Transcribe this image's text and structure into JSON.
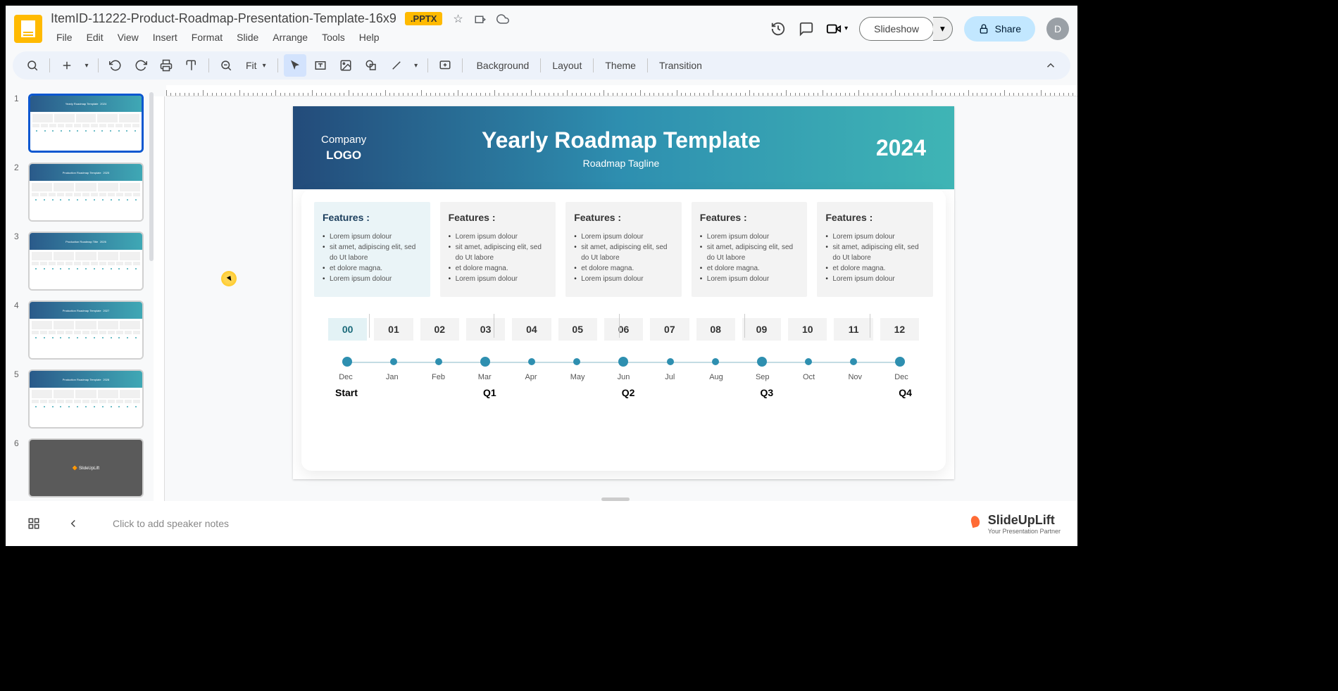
{
  "doc": {
    "name": "ItemID-11222-Product-Roadmap-Presentation-Template-16x9",
    "badge": ".PPTX"
  },
  "menus": [
    "File",
    "Edit",
    "View",
    "Insert",
    "Format",
    "Slide",
    "Arrange",
    "Tools",
    "Help"
  ],
  "header_actions": {
    "slideshow": "Slideshow",
    "share": "Share",
    "avatar": "D"
  },
  "toolbar": {
    "zoom": "Fit",
    "text_tools": [
      "Background",
      "Layout",
      "Theme",
      "Transition"
    ]
  },
  "thumbnails": [
    {
      "num": "1",
      "title": "Yearly Roadmap Template",
      "year": "2024",
      "active": true
    },
    {
      "num": "2",
      "title": "Production Roadmap Template",
      "year": "2025",
      "active": false
    },
    {
      "num": "3",
      "title": "Production Roadmap Title",
      "year": "2026",
      "active": false
    },
    {
      "num": "4",
      "title": "Production Roadmap Template",
      "year": "2027",
      "active": false
    },
    {
      "num": "5",
      "title": "Production Roadmap Template",
      "year": "2028",
      "active": false
    },
    {
      "num": "6",
      "title": "",
      "year": "",
      "active": false,
      "dark": true,
      "brand": "🔶 SlideUpLift"
    }
  ],
  "slide": {
    "company": "Company",
    "logo": "LOGO",
    "title": "Yearly Roadmap Template",
    "tagline": "Roadmap Tagline",
    "year": "2024",
    "features": [
      {
        "title": "Features :",
        "items": [
          "Lorem ipsum dolour",
          "sit amet, adipiscing elit, sed do Ut labore",
          "et dolore magna.",
          "Lorem ipsum dolour"
        ]
      },
      {
        "title": "Features :",
        "items": [
          "Lorem ipsum dolour",
          "sit amet, adipiscing elit, sed do Ut labore",
          "et dolore magna.",
          "Lorem ipsum dolour"
        ]
      },
      {
        "title": "Features :",
        "items": [
          "Lorem ipsum dolour",
          "sit amet, adipiscing elit, sed do Ut labore",
          "et dolore magna.",
          "Lorem ipsum dolour"
        ]
      },
      {
        "title": "Features :",
        "items": [
          "Lorem ipsum dolour",
          "sit amet, adipiscing elit, sed do Ut labore",
          "et dolore magna.",
          "Lorem ipsum dolour"
        ]
      },
      {
        "title": "Features :",
        "items": [
          "Lorem ipsum dolour",
          "sit amet, adipiscing elit, sed do Ut labore",
          "et dolore magna.",
          "Lorem ipsum dolour"
        ]
      }
    ],
    "numbers": [
      "00",
      "01",
      "02",
      "03",
      "04",
      "05",
      "06",
      "07",
      "08",
      "09",
      "10",
      "11",
      "12"
    ],
    "months": [
      "Dec",
      "Jan",
      "Feb",
      "Mar",
      "Apr",
      "May",
      "Jun",
      "Jul",
      "Aug",
      "Sep",
      "Oct",
      "Nov",
      "Dec"
    ],
    "quarters": [
      "Start",
      "Q1",
      "Q2",
      "Q3",
      "Q4"
    ],
    "big_dots": [
      0,
      3,
      6,
      9,
      12
    ]
  },
  "notes": {
    "placeholder": "Click to add speaker notes"
  },
  "branding": {
    "name": "SlideUpLift",
    "tagline": "Your Presentation Partner"
  }
}
